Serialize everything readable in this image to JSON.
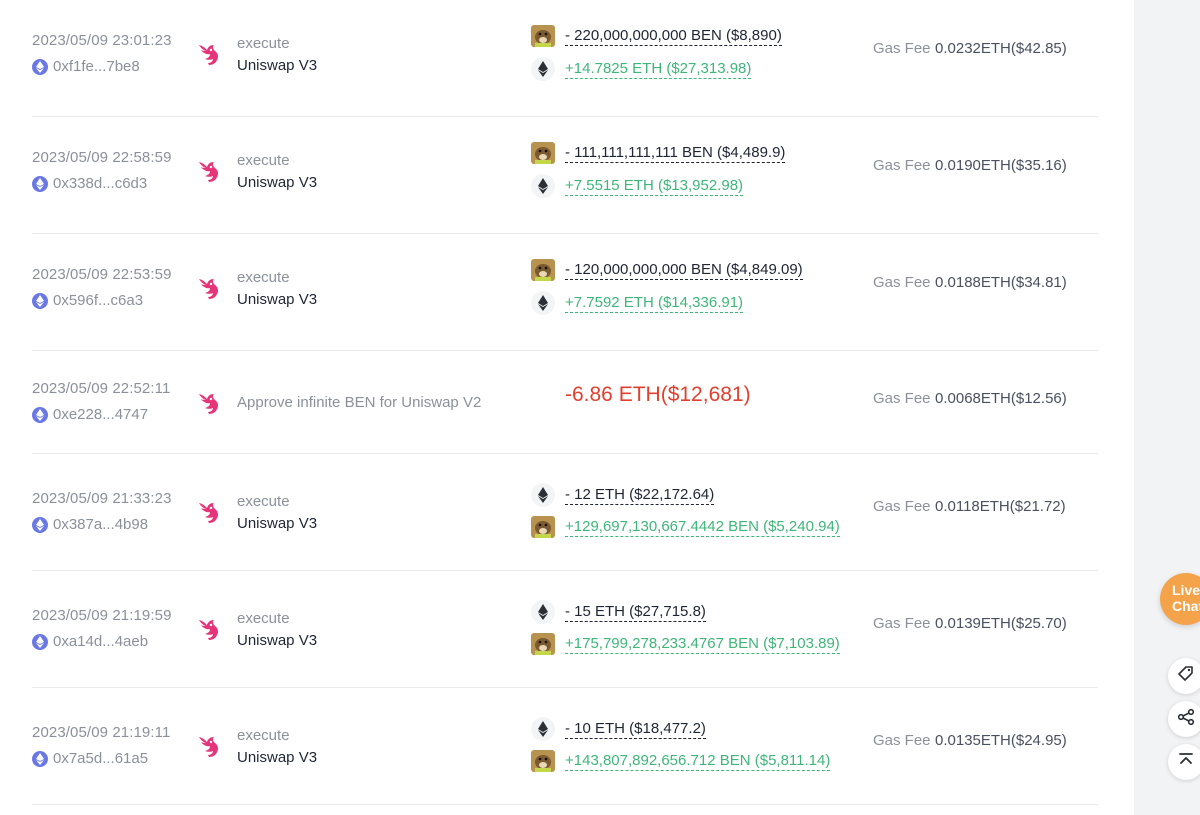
{
  "rows": [
    {
      "time": "2023/05/09 23:01:23",
      "hash": "0xf1fe...7be8",
      "action": "execute",
      "protocol": "Uniswap V3",
      "first": {
        "token": "ben",
        "text": "- 220,000,000,000 BEN ($8,890)"
      },
      "second": {
        "token": "eth",
        "text": "+14.7825 ETH ($27,313.98)"
      },
      "gas_label": "Gas Fee",
      "gas": "0.0232ETH($42.85)"
    },
    {
      "time": "2023/05/09 22:58:59",
      "hash": "0x338d...c6d3",
      "action": "execute",
      "protocol": "Uniswap V3",
      "first": {
        "token": "ben",
        "text": "- 111,111,111,111 BEN ($4,489.9)"
      },
      "second": {
        "token": "eth",
        "text": "+7.5515 ETH ($13,952.98)"
      },
      "gas_label": "Gas Fee",
      "gas": "0.0190ETH($35.16)"
    },
    {
      "time": "2023/05/09 22:53:59",
      "hash": "0x596f...c6a3",
      "action": "execute",
      "protocol": "Uniswap V3",
      "first": {
        "token": "ben",
        "text": "- 120,000,000,000 BEN ($4,849.09)"
      },
      "second": {
        "token": "eth",
        "text": "+7.7592 ETH ($14,336.91)"
      },
      "gas_label": "Gas Fee",
      "gas": "0.0188ETH($34.81)"
    },
    {
      "time": "2023/05/09 22:52:11",
      "hash": "0xe228...4747",
      "approve": "Approve infinite BEN for Uniswap V2",
      "amount": "-6.86 ETH($12,681)",
      "gas_label": "Gas Fee",
      "gas": "0.0068ETH($12.56)"
    },
    {
      "time": "2023/05/09 21:33:23",
      "hash": "0x387a...4b98",
      "action": "execute",
      "protocol": "Uniswap V3",
      "first": {
        "token": "eth",
        "text": "- 12 ETH ($22,172.64)"
      },
      "second": {
        "token": "ben",
        "text": "+129,697,130,667.4442 BEN ($5,240.94)"
      },
      "gas_label": "Gas Fee",
      "gas": "0.0118ETH($21.72)"
    },
    {
      "time": "2023/05/09 21:19:59",
      "hash": "0xa14d...4aeb",
      "action": "execute",
      "protocol": "Uniswap V3",
      "first": {
        "token": "eth",
        "text": "- 15 ETH ($27,715.8)"
      },
      "second": {
        "token": "ben",
        "text": "+175,799,278,233.4767 BEN ($7,103.89)"
      },
      "gas_label": "Gas Fee",
      "gas": "0.0139ETH($25.70)"
    },
    {
      "time": "2023/05/09 21:19:11",
      "hash": "0x7a5d...61a5",
      "action": "execute",
      "protocol": "Uniswap V3",
      "first": {
        "token": "eth",
        "text": "- 10 ETH ($18,477.2)"
      },
      "second": {
        "token": "ben",
        "text": "+143,807,892,656.712 BEN ($5,811.14)"
      },
      "gas_label": "Gas Fee",
      "gas": "0.0135ETH($24.95)"
    }
  ],
  "sidebar": {
    "live_chat_1": "Live",
    "live_chat_2": "Chat",
    "buttons": [
      "tag-icon",
      "share-icon",
      "scroll-top-icon"
    ]
  },
  "colors": {
    "positive": "#3fb57a",
    "negative": "#e2402f",
    "uniswap": "#e6347a",
    "accent_orange": "#f5a34a"
  }
}
